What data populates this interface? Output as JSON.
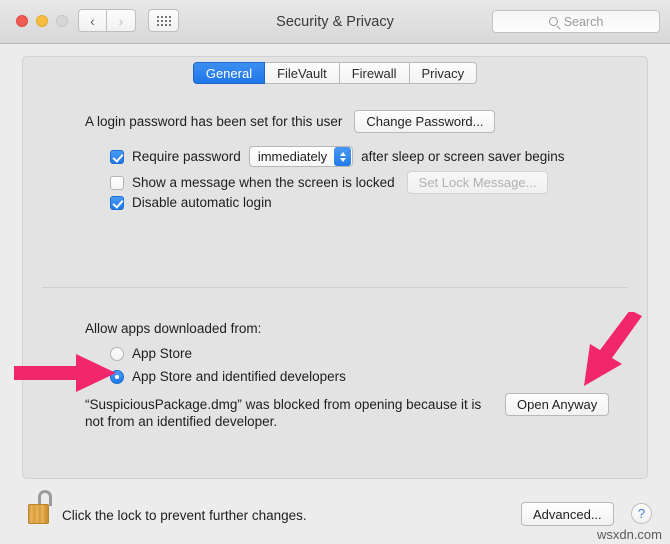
{
  "window": {
    "title": "Security & Privacy",
    "traffic_lights": [
      "close",
      "minimize",
      "zoom"
    ],
    "nav_back": "‹",
    "nav_forward": "›",
    "grid_button": "show-all"
  },
  "search": {
    "placeholder": "Search"
  },
  "tabs": [
    {
      "label": "General",
      "active": true
    },
    {
      "label": "FileVault",
      "active": false
    },
    {
      "label": "Firewall",
      "active": false
    },
    {
      "label": "Privacy",
      "active": false
    }
  ],
  "general": {
    "password_status": "A login password has been set for this user",
    "change_password_button": "Change Password...",
    "require_password": {
      "label_before": "Require password",
      "interval": "immediately",
      "label_after": "after sleep or screen saver begins",
      "checked": true
    },
    "show_message": {
      "label": "Show a message when the screen is locked",
      "checked": false,
      "button": "Set Lock Message...",
      "button_disabled": true
    },
    "disable_auto_login": {
      "label": "Disable automatic login",
      "checked": true
    }
  },
  "allow_apps": {
    "title": "Allow apps downloaded from:",
    "options": [
      {
        "label": "App Store",
        "selected": false
      },
      {
        "label": "App Store and identified developers",
        "selected": true
      }
    ],
    "blocked_message": "“SuspiciousPackage.dmg” was blocked from opening because it is not from an identified developer.",
    "open_anyway_button": "Open Anyway"
  },
  "footer": {
    "lock_text": "Click the lock to prevent further changes.",
    "advanced_button": "Advanced...",
    "help_button": "?"
  },
  "watermark": "wsxdn.com",
  "colors": {
    "accent_blue": "#1f7ae8",
    "annotation_pink": "#f2266b",
    "lock_gold": "#d89b3c",
    "window_bg": "#ececec",
    "panel_bg": "#e3e3e3"
  }
}
